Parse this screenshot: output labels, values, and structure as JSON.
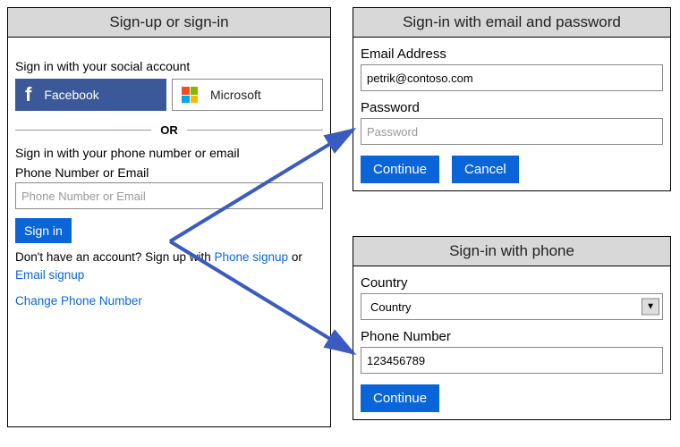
{
  "colors": {
    "primary": "#0a66d8",
    "fb": "#3b5998"
  },
  "left": {
    "title": "Sign-up or sign-in",
    "social_label": "Sign in with your social account",
    "facebook": "Facebook",
    "microsoft": "Microsoft",
    "divider": "OR",
    "phone_email_label": "Sign in with your phone number or email",
    "field_label": "Phone Number or Email",
    "field_placeholder": "Phone Number or Email",
    "signin": "Sign in",
    "no_account_prefix": "Don't have an account? Sign up with ",
    "phone_signup": "Phone signup",
    "or": " or ",
    "email_signup": "Email signup",
    "change_phone": "Change Phone Number"
  },
  "email_panel": {
    "title": "Sign-in with email and password",
    "email_label": "Email Address",
    "email_value": "petrik@contoso.com",
    "password_label": "Password",
    "password_placeholder": "Password",
    "continue": "Continue",
    "cancel": "Cancel"
  },
  "phone_panel": {
    "title": "Sign-in with phone",
    "country_label": "Country",
    "country_value": "Country",
    "phone_label": "Phone Number",
    "phone_value": "123456789",
    "continue": "Continue"
  }
}
